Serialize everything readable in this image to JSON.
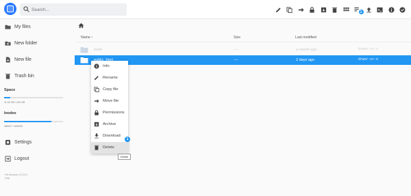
{
  "search": {
    "placeholder": "Search..."
  },
  "header": {
    "icons": [
      "edit-icon",
      "copy-icon",
      "move-icon",
      "lock-icon",
      "archive-icon",
      "delete-icon",
      "view-mode-icon",
      "upload-queue-icon",
      "upload-icon",
      "shell-icon",
      "info-icon",
      "select-icon"
    ],
    "upload_badge": "1"
  },
  "sidebar": {
    "my_files": "My files",
    "new_folder": "New folder",
    "new_file": "New file",
    "trash_bin": "Trash bin",
    "space_label": "Space",
    "space_usage": "11.02 GB / 100 GB",
    "space_fraction": 0.11,
    "inodes_label": "Inodes",
    "inodes_usage": "485917 / 609000",
    "inodes_fraction": 0.8,
    "settings": "Settings",
    "logout": "Logout",
    "footer_line1": "File Browser v2.23.0",
    "footer_line2": "Help"
  },
  "table": {
    "col_name": "Name ↑",
    "col_size": "Size",
    "col_modified": "Last modified",
    "rows": [
      {
        "name": "trash",
        "size": "—",
        "modified": "a month ago",
        "perms": "drwxr-xr-x"
      },
      {
        "name": "public_html",
        "size": "—",
        "modified": "2 days ago",
        "perms": "drwxr-xr-x"
      }
    ]
  },
  "context_menu": {
    "items": [
      "Info",
      "Rename",
      "Copy file",
      "Move file",
      "Permissions",
      "Archive",
      "Download",
      "Delete"
    ],
    "download_badge": "1",
    "tooltip": "Delete"
  },
  "colors": {
    "accent": "#2196f3",
    "logo": "#2979ff"
  }
}
